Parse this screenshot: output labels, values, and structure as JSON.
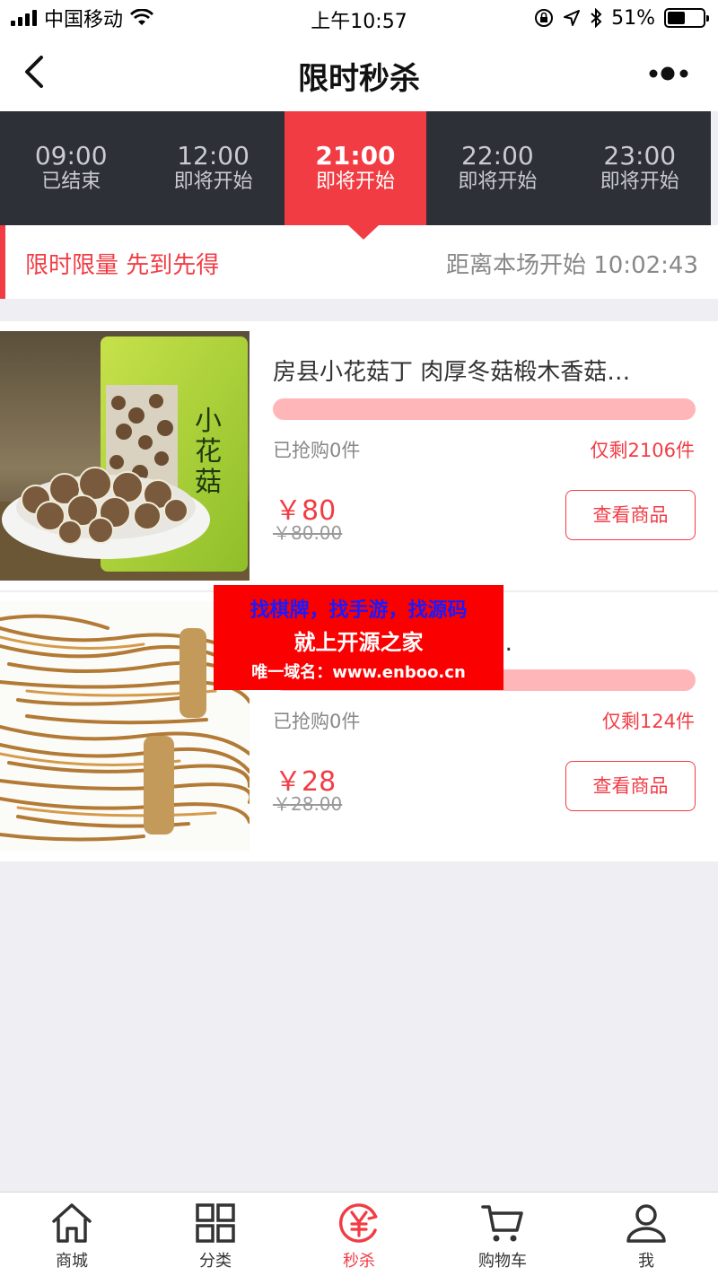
{
  "status_bar": {
    "carrier": "中国移动",
    "time": "上午10:57",
    "battery": "51%"
  },
  "header": {
    "title": "限时秒杀"
  },
  "time_tabs": [
    {
      "time": "09:00",
      "status": "已结束"
    },
    {
      "time": "12:00",
      "status": "即将开始"
    },
    {
      "time": "21:00",
      "status": "即将开始"
    },
    {
      "time": "22:00",
      "status": "即将开始"
    },
    {
      "time": "23:00",
      "status": "即将开始"
    }
  ],
  "info": {
    "slogan": "限时限量 先到先得",
    "countdown_label": "距离本场开始",
    "countdown": "10:02:43"
  },
  "products": [
    {
      "name": "房县小花菇丁 肉厚冬菇椴木香菇…",
      "sold": "已抢购0件",
      "remaining": "仅剩2106件",
      "price": "￥80",
      "original_price": "￥80.00",
      "button": "查看商品",
      "progress": 0
    },
    {
      "name": "房县野生竹笋笋子20…",
      "sold": "已抢购0件",
      "remaining": "仅剩124件",
      "price": "￥28",
      "original_price": "￥28.00",
      "button": "查看商品",
      "progress": 0
    }
  ],
  "watermark": {
    "line1": "找棋牌，找手游，找源码",
    "line2": "就上开源之家",
    "line3": "唯一域名：www.enboo.cn"
  },
  "bottom_nav": [
    {
      "label": "商城",
      "icon": "home-icon"
    },
    {
      "label": "分类",
      "icon": "grid-icon"
    },
    {
      "label": "秒杀",
      "icon": "yen-icon"
    },
    {
      "label": "购物车",
      "icon": "cart-icon"
    },
    {
      "label": "我",
      "icon": "user-icon"
    }
  ],
  "colors": {
    "accent": "#f23c44",
    "tab_bar": "#2d3037"
  }
}
